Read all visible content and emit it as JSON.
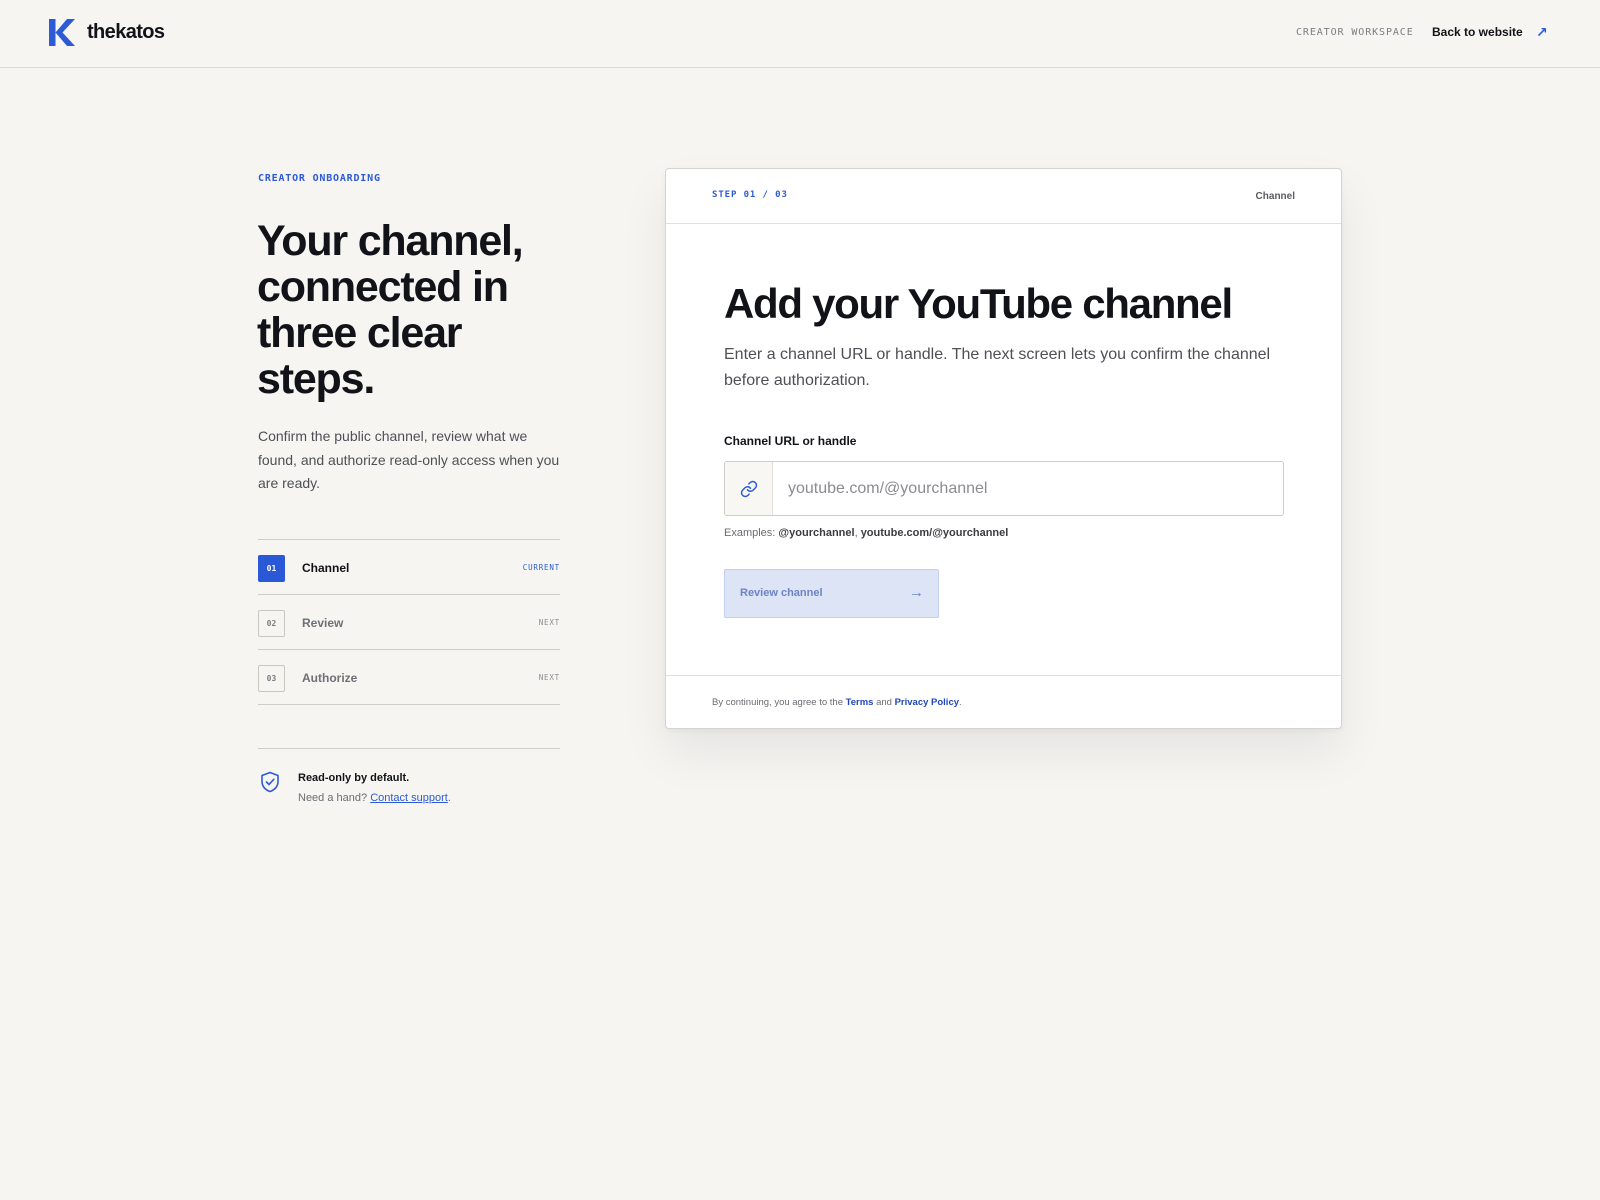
{
  "header": {
    "brand": "thekatos",
    "workspace_label": "CREATOR WORKSPACE",
    "back_link": "Back to website",
    "back_icon": "external-arrow-icon",
    "accent_color": "#2d5bd8"
  },
  "intro": {
    "eyebrow": "CREATOR ONBOARDING",
    "headline": "Your channel, connected in three clear steps.",
    "lede": "Confirm the public channel, review what we found, and authorize read-only access when you are ready."
  },
  "steps": [
    {
      "number": "01",
      "label": "Channel",
      "status": "CURRENT",
      "state": "current"
    },
    {
      "number": "02",
      "label": "Review",
      "status": "NEXT",
      "state": "upcoming"
    },
    {
      "number": "03",
      "label": "Authorize",
      "status": "NEXT",
      "state": "upcoming"
    }
  ],
  "note": {
    "title": "Read-only by default.",
    "prefix": "Need a hand?",
    "link": "Contact support",
    "suffix": ".",
    "icon": "shield-check-icon"
  },
  "card": {
    "step_indicator": "STEP 01 / 03",
    "crumb": "Channel",
    "title": "Add your YouTube channel",
    "description": "Enter a channel URL or handle. The next screen lets you confirm the channel before authorization.",
    "field": {
      "label": "Channel URL or handle",
      "placeholder": "youtube.com/@yourchannel",
      "value": "",
      "icon": "link-icon"
    },
    "hint": {
      "prefix": "Examples: ",
      "example_1": "@yourchannel",
      "separator": ", ",
      "example_2": "youtube.com/@yourchannel"
    },
    "submit": {
      "label": "Review channel",
      "arrow": "→",
      "disabled": true
    },
    "legal": {
      "prefix": "By continuing, you agree to the ",
      "terms": "Terms",
      "and": " and ",
      "privacy": "Privacy Policy",
      "suffix": "."
    }
  }
}
